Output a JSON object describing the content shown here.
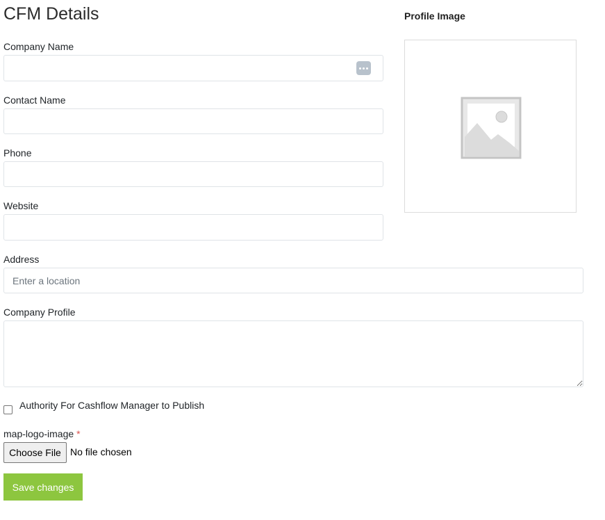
{
  "page": {
    "title": "CFM Details"
  },
  "form": {
    "company_name": {
      "label": "Company Name",
      "value": ""
    },
    "contact_name": {
      "label": "Contact Name",
      "value": ""
    },
    "phone": {
      "label": "Phone",
      "value": ""
    },
    "website": {
      "label": "Website",
      "value": ""
    },
    "address": {
      "label": "Address",
      "value": "",
      "placeholder": "Enter a location"
    },
    "company_profile": {
      "label": "Company Profile",
      "value": ""
    },
    "authority": {
      "label": "Authority For Cashflow Manager to Publish",
      "checked": false
    },
    "map_logo": {
      "label": "map-logo-image",
      "required_mark": "*",
      "button_label": "Choose File",
      "status": "No file chosen"
    },
    "save_label": "Save changes"
  },
  "profile_image": {
    "heading": "Profile Image",
    "icon": "image-placeholder-icon"
  },
  "colors": {
    "accent": "#8dc63f",
    "required": "#d9534f",
    "border": "#dfe3e7"
  }
}
